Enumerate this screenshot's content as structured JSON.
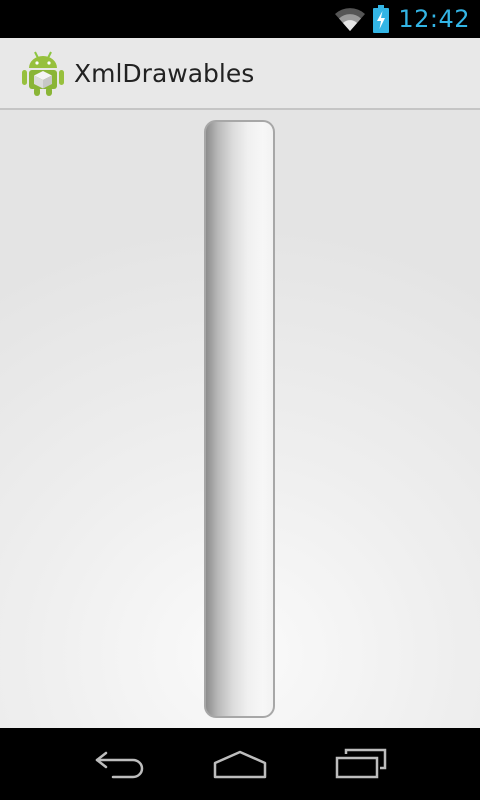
{
  "status_bar": {
    "time": "12:42",
    "time_color": "#33b5e5",
    "icons": [
      "wifi-icon",
      "battery-charging-icon"
    ]
  },
  "action_bar": {
    "title": "XmlDrawables",
    "icon": "android-app-icon"
  },
  "content": {
    "shape": "vertical-gradient-bar"
  },
  "nav_bar": {
    "buttons": [
      "back-icon",
      "home-icon",
      "recent-apps-icon"
    ]
  }
}
